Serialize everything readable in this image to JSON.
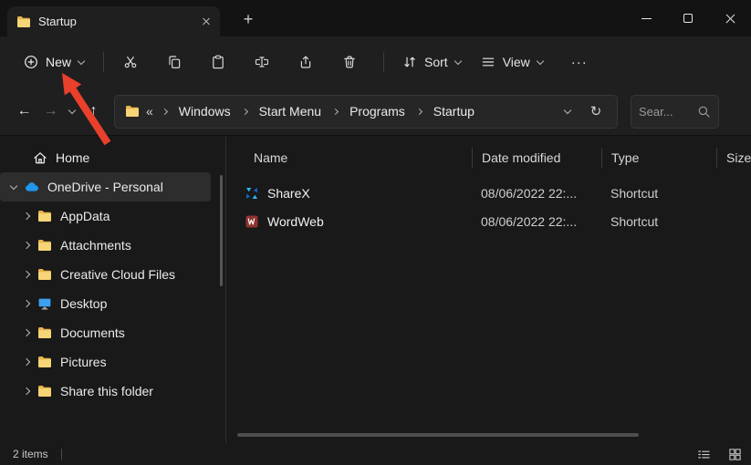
{
  "window": {
    "tab_title": "Startup",
    "new_tab_glyph": "+"
  },
  "toolbar": {
    "new_label": "New",
    "sort_label": "Sort",
    "view_label": "View",
    "more_glyph": "···"
  },
  "nav_icons": {
    "back": "←",
    "forward": "→",
    "up": "↑",
    "refresh": "↻"
  },
  "address": {
    "overflow": "«",
    "crumbs": [
      "Windows",
      "Start Menu",
      "Programs",
      "Startup"
    ],
    "search_placeholder": "Sear..."
  },
  "sidebar": {
    "items": [
      {
        "label": "Home",
        "icon": "home"
      },
      {
        "label": "OneDrive - Personal",
        "icon": "onedrive-cloud"
      },
      {
        "label": "AppData",
        "icon": "folder"
      },
      {
        "label": "Attachments",
        "icon": "folder"
      },
      {
        "label": "Creative Cloud Files",
        "icon": "folder"
      },
      {
        "label": "Desktop",
        "icon": "desktop"
      },
      {
        "label": "Documents",
        "icon": "folder"
      },
      {
        "label": "Pictures",
        "icon": "folder"
      },
      {
        "label": "Share this folder",
        "icon": "folder"
      }
    ]
  },
  "files": {
    "columns": {
      "name": "Name",
      "date": "Date modified",
      "type": "Type",
      "size": "Size"
    },
    "rows": [
      {
        "name": "ShareX",
        "date": "08/06/2022 22:...",
        "type": "Shortcut",
        "icon": "sharex"
      },
      {
        "name": "WordWeb",
        "date": "08/06/2022 22:...",
        "type": "Shortcut",
        "icon": "wordweb"
      }
    ]
  },
  "statusbar": {
    "count": "2 items"
  },
  "colors": {
    "arrow": "#e8402c"
  }
}
